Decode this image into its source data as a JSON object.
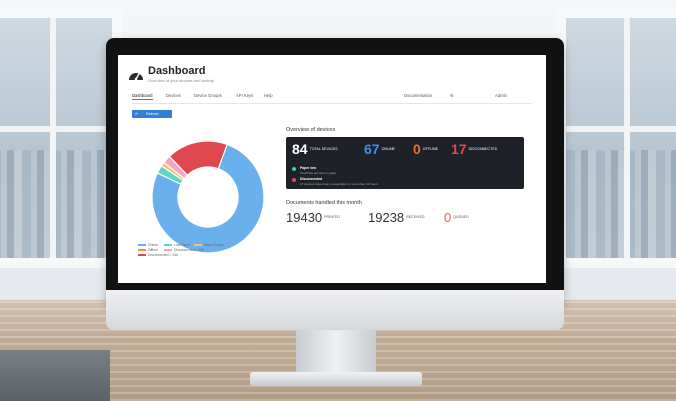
{
  "app": {
    "title": "Dashboard",
    "subtitle": "Overview of your devices and activity"
  },
  "nav": {
    "tabs": [
      {
        "label": "Dashboard"
      },
      {
        "label": "Devices"
      },
      {
        "label": "Device Groups"
      },
      {
        "label": "API Keys"
      },
      {
        "label": "Help"
      }
    ],
    "documentation": "Documentation",
    "account": "Admin",
    "settings_icon": "gear-icon"
  },
  "toolbar": {
    "refresh_label": "Refresh",
    "refresh_icon": "refresh-icon"
  },
  "overview": {
    "title": "Overview of devices",
    "total": {
      "value": "84",
      "label": "TOTAL DEVICES"
    },
    "online": {
      "value": "67",
      "label": "ONLINE"
    },
    "offline": {
      "value": "0",
      "label": "OFFLINE"
    },
    "disconnected": {
      "value": "17",
      "label": "DISCONNECTED"
    },
    "alerts": [
      {
        "title": "Paper low",
        "text": "Two/three are low on paper",
        "color": "#3dd0a0"
      },
      {
        "title": "Disconnected",
        "text": "17 devices have been unreachable for more than 24 hours",
        "color": "#e5484d"
      }
    ]
  },
  "documents": {
    "title": "Documents handled this month",
    "printed": {
      "value": "19430",
      "label": "PRINTED"
    },
    "received": {
      "value": "19238",
      "label": "RECEIVED"
    },
    "queued": {
      "value": "0",
      "label": "QUEUED"
    }
  },
  "chart_data": {
    "type": "pie",
    "title": "",
    "categories": [
      "Online",
      "Low Paper",
      "Paper Empty",
      "Offline",
      "Disconnected < 24h",
      "Disconnected > 24h"
    ],
    "values": [
      65,
      2,
      1,
      0,
      2,
      15
    ],
    "colors": [
      "#6ab0ec",
      "#5fd6c5",
      "#f5c26b",
      "#f28f3b",
      "#f3a6c4",
      "#e0474f"
    ]
  },
  "colors": {
    "accent": "#2f7fd8",
    "online": "#2f7fd8",
    "offline": "#f5672b",
    "disconnected": "#e5484d"
  }
}
